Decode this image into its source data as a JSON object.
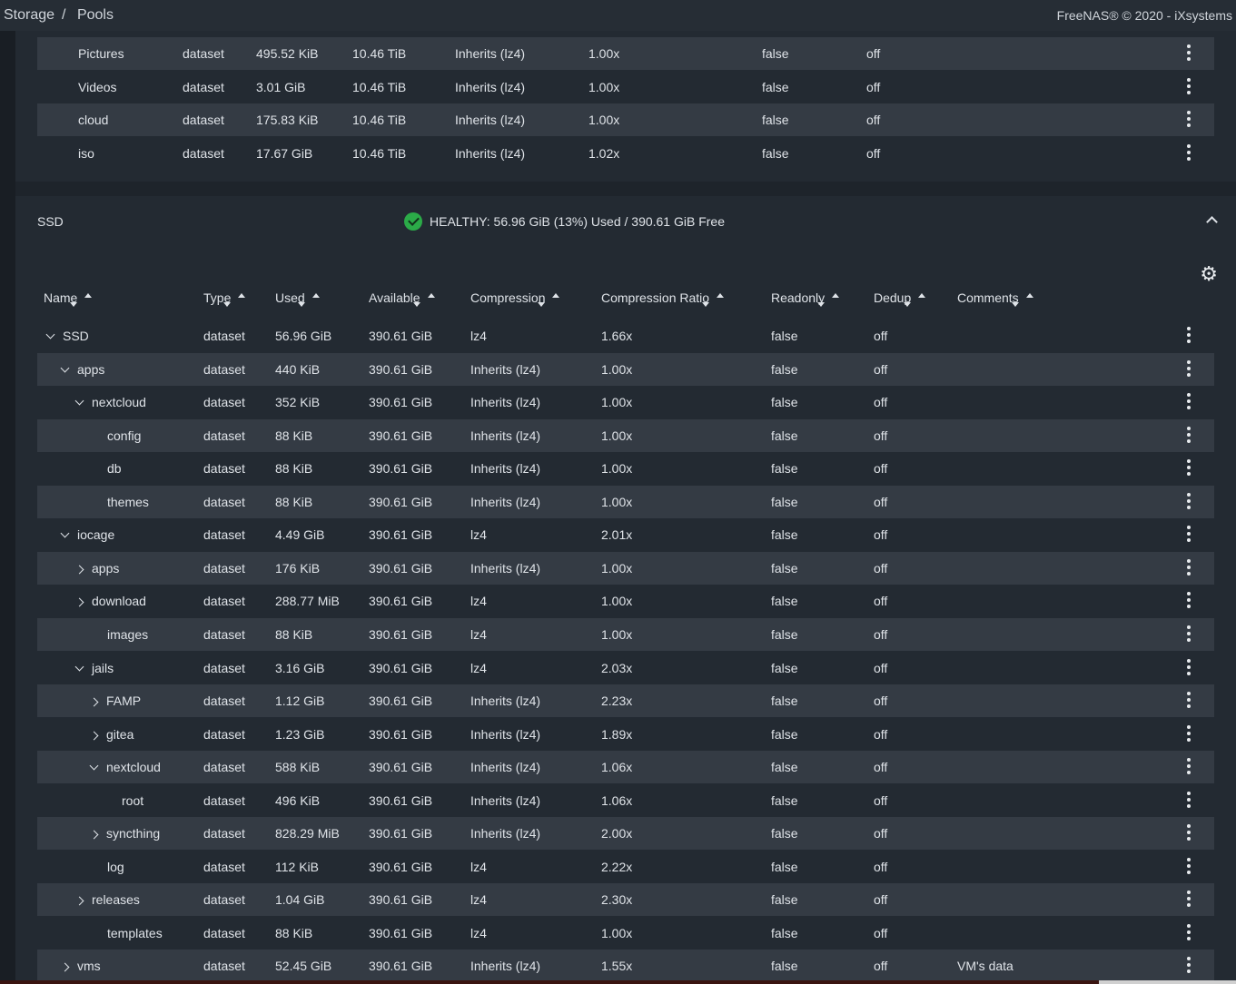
{
  "header": {
    "breadcrumb": [
      "Storage",
      "Pools"
    ],
    "copyright": "FreeNAS® © 2020 - iXsystems"
  },
  "top_pool_rows": [
    {
      "name": "Pictures",
      "type": "dataset",
      "used": "495.52 KiB",
      "available": "10.46 TiB",
      "compression": "Inherits (lz4)",
      "ratio": "1.00x",
      "readonly": "false",
      "dedup": "off"
    },
    {
      "name": "Videos",
      "type": "dataset",
      "used": "3.01 GiB",
      "available": "10.46 TiB",
      "compression": "Inherits (lz4)",
      "ratio": "1.00x",
      "readonly": "false",
      "dedup": "off"
    },
    {
      "name": "cloud",
      "type": "dataset",
      "used": "175.83 KiB",
      "available": "10.46 TiB",
      "compression": "Inherits (lz4)",
      "ratio": "1.00x",
      "readonly": "false",
      "dedup": "off"
    },
    {
      "name": "iso",
      "type": "dataset",
      "used": "17.67 GiB",
      "available": "10.46 TiB",
      "compression": "Inherits (lz4)",
      "ratio": "1.02x",
      "readonly": "false",
      "dedup": "off"
    }
  ],
  "ssd_pool": {
    "name": "SSD",
    "status": "HEALTHY: 56.96 GiB (13%) Used / 390.61 GiB Free",
    "columns": [
      "Name",
      "Type",
      "Used",
      "Available",
      "Compression",
      "Compression Ratio",
      "Readonly",
      "Dedup",
      "Comments"
    ],
    "rows": [
      {
        "name": "SSD",
        "level": 0,
        "toggle": "down",
        "type": "dataset",
        "used": "56.96 GiB",
        "available": "390.61 GiB",
        "compression": "lz4",
        "ratio": "1.66x",
        "readonly": "false",
        "dedup": "off",
        "comments": ""
      },
      {
        "name": "apps",
        "level": 1,
        "toggle": "down",
        "type": "dataset",
        "used": "440 KiB",
        "available": "390.61 GiB",
        "compression": "Inherits (lz4)",
        "ratio": "1.00x",
        "readonly": "false",
        "dedup": "off",
        "comments": ""
      },
      {
        "name": "nextcloud",
        "level": 2,
        "toggle": "down",
        "type": "dataset",
        "used": "352 KiB",
        "available": "390.61 GiB",
        "compression": "Inherits (lz4)",
        "ratio": "1.00x",
        "readonly": "false",
        "dedup": "off",
        "comments": ""
      },
      {
        "name": "config",
        "level": 3,
        "toggle": "",
        "type": "dataset",
        "used": "88 KiB",
        "available": "390.61 GiB",
        "compression": "Inherits (lz4)",
        "ratio": "1.00x",
        "readonly": "false",
        "dedup": "off",
        "comments": ""
      },
      {
        "name": "db",
        "level": 3,
        "toggle": "",
        "type": "dataset",
        "used": "88 KiB",
        "available": "390.61 GiB",
        "compression": "Inherits (lz4)",
        "ratio": "1.00x",
        "readonly": "false",
        "dedup": "off",
        "comments": ""
      },
      {
        "name": "themes",
        "level": 3,
        "toggle": "",
        "type": "dataset",
        "used": "88 KiB",
        "available": "390.61 GiB",
        "compression": "Inherits (lz4)",
        "ratio": "1.00x",
        "readonly": "false",
        "dedup": "off",
        "comments": ""
      },
      {
        "name": "iocage",
        "level": 1,
        "toggle": "down",
        "type": "dataset",
        "used": "4.49 GiB",
        "available": "390.61 GiB",
        "compression": "lz4",
        "ratio": "2.01x",
        "readonly": "false",
        "dedup": "off",
        "comments": ""
      },
      {
        "name": "apps",
        "level": 2,
        "toggle": "right",
        "type": "dataset",
        "used": "176 KiB",
        "available": "390.61 GiB",
        "compression": "Inherits (lz4)",
        "ratio": "1.00x",
        "readonly": "false",
        "dedup": "off",
        "comments": ""
      },
      {
        "name": "download",
        "level": 2,
        "toggle": "right",
        "type": "dataset",
        "used": "288.77 MiB",
        "available": "390.61 GiB",
        "compression": "lz4",
        "ratio": "1.00x",
        "readonly": "false",
        "dedup": "off",
        "comments": ""
      },
      {
        "name": "images",
        "level": 3,
        "toggle": "",
        "type": "dataset",
        "used": "88 KiB",
        "available": "390.61 GiB",
        "compression": "lz4",
        "ratio": "1.00x",
        "readonly": "false",
        "dedup": "off",
        "comments": ""
      },
      {
        "name": "jails",
        "level": 2,
        "toggle": "down",
        "type": "dataset",
        "used": "3.16 GiB",
        "available": "390.61 GiB",
        "compression": "lz4",
        "ratio": "2.03x",
        "readonly": "false",
        "dedup": "off",
        "comments": ""
      },
      {
        "name": "FAMP",
        "level": 3,
        "toggle": "right",
        "type": "dataset",
        "used": "1.12 GiB",
        "available": "390.61 GiB",
        "compression": "Inherits (lz4)",
        "ratio": "2.23x",
        "readonly": "false",
        "dedup": "off",
        "comments": ""
      },
      {
        "name": "gitea",
        "level": 3,
        "toggle": "right",
        "type": "dataset",
        "used": "1.23 GiB",
        "available": "390.61 GiB",
        "compression": "Inherits (lz4)",
        "ratio": "1.89x",
        "readonly": "false",
        "dedup": "off",
        "comments": ""
      },
      {
        "name": "nextcloud",
        "level": 3,
        "toggle": "down",
        "type": "dataset",
        "used": "588 KiB",
        "available": "390.61 GiB",
        "compression": "Inherits (lz4)",
        "ratio": "1.06x",
        "readonly": "false",
        "dedup": "off",
        "comments": ""
      },
      {
        "name": "root",
        "level": 4,
        "toggle": "",
        "type": "dataset",
        "used": "496 KiB",
        "available": "390.61 GiB",
        "compression": "Inherits (lz4)",
        "ratio": "1.06x",
        "readonly": "false",
        "dedup": "off",
        "comments": ""
      },
      {
        "name": "syncthing",
        "level": 3,
        "toggle": "right",
        "type": "dataset",
        "used": "828.29 MiB",
        "available": "390.61 GiB",
        "compression": "Inherits (lz4)",
        "ratio": "2.00x",
        "readonly": "false",
        "dedup": "off",
        "comments": ""
      },
      {
        "name": "log",
        "level": 3,
        "toggle": "",
        "type": "dataset",
        "used": "112 KiB",
        "available": "390.61 GiB",
        "compression": "lz4",
        "ratio": "2.22x",
        "readonly": "false",
        "dedup": "off",
        "comments": ""
      },
      {
        "name": "releases",
        "level": 2,
        "toggle": "right",
        "type": "dataset",
        "used": "1.04 GiB",
        "available": "390.61 GiB",
        "compression": "lz4",
        "ratio": "2.30x",
        "readonly": "false",
        "dedup": "off",
        "comments": ""
      },
      {
        "name": "templates",
        "level": 3,
        "toggle": "",
        "type": "dataset",
        "used": "88 KiB",
        "available": "390.61 GiB",
        "compression": "lz4",
        "ratio": "1.00x",
        "readonly": "false",
        "dedup": "off",
        "comments": ""
      },
      {
        "name": "vms",
        "level": 1,
        "toggle": "right",
        "type": "dataset",
        "used": "52.45 GiB",
        "available": "390.61 GiB",
        "compression": "Inherits (lz4)",
        "ratio": "1.55x",
        "readonly": "false",
        "dedup": "off",
        "comments": "VM's data"
      }
    ]
  },
  "colors": {
    "healthy": "#2bab48",
    "row_alt": "#343b44",
    "card": "#232a32"
  }
}
